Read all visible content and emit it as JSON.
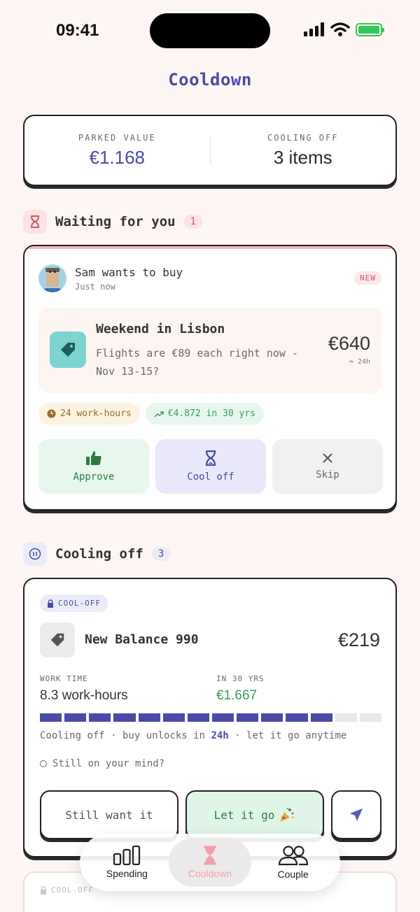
{
  "status_bar": {
    "time": "09:41"
  },
  "app": {
    "title": "Cooldown"
  },
  "summary": {
    "parked_label": "PARKED VALUE",
    "parked_value": "€1.168",
    "cooling_label": "COOLING OFF",
    "cooling_value": "3 items"
  },
  "waiting_section": {
    "title": "Waiting for you",
    "count": "1"
  },
  "request": {
    "requester": "Sam wants to buy",
    "time": "Just now",
    "badge": "NEW",
    "item_title": "Weekend in Lisbon",
    "item_desc": "Flights are €89 each right now - Nov 13-15?",
    "price": "€640",
    "hours": "≈ 24h",
    "chip_hours": "24 work-hours",
    "chip_growth": "€4.872 in 30 yrs",
    "actions": {
      "approve": "Approve",
      "cool_off": "Cool off",
      "skip": "Skip"
    }
  },
  "cooling_section": {
    "title": "Cooling off",
    "count": "3"
  },
  "cooling_item": {
    "badge": "COOL-OFF",
    "name": "New Balance 990",
    "price": "€219",
    "work_time_label": "WORK TIME",
    "work_time_value": "8.3 work-hours",
    "growth_label": "IN 30 YRS",
    "growth_value": "€1.667",
    "progress_filled": 12,
    "progress_total": 14,
    "note_prefix": "Cooling off · buy unlocks in ",
    "note_highlight": "24h",
    "note_suffix": " · let it go anytime",
    "check_label": "Still on your mind?",
    "still_want": "Still want it",
    "let_go": "Let it go"
  },
  "peek_card": {
    "badge": "COOL-OFF"
  },
  "nav": {
    "spending": "Spending",
    "cooldown": "Cooldown",
    "couple": "Couple"
  },
  "colors": {
    "accent": "#4a4aa8",
    "green": "#3b9a5a",
    "pink": "#f0a1ab"
  }
}
